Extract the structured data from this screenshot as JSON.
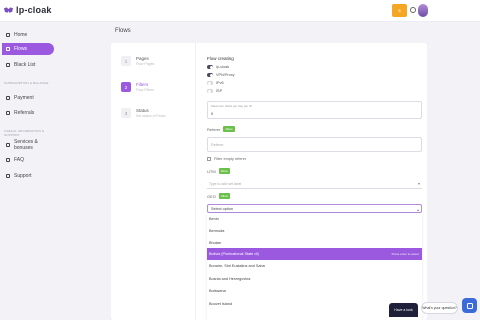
{
  "app": {
    "name": "lp-cloak"
  },
  "topbar": {
    "button_label": "$"
  },
  "sidebar": {
    "items": [
      {
        "label": "Home",
        "icon": "home-icon"
      },
      {
        "label": "Flows",
        "icon": "flows-icon",
        "active": true
      },
      {
        "label": "Black List",
        "icon": "blacklist-icon"
      }
    ],
    "section1": "SUBSCRIPTION & BALANCE",
    "items2": [
      {
        "label": "Payment",
        "icon": "payment-icon"
      },
      {
        "label": "Referrals",
        "icon": "referrals-icon"
      }
    ],
    "section2": "USEFUL INFORMATION & SUPPORT",
    "items3": [
      {
        "label": "Services & bonuses",
        "icon": "services-icon"
      },
      {
        "label": "FAQ",
        "icon": "faq-icon"
      },
      {
        "label": "Support",
        "icon": "support-icon"
      }
    ]
  },
  "page": {
    "title": "Flows"
  },
  "steps": [
    {
      "num": "1",
      "title": "Pages",
      "sub": "Flow Pages"
    },
    {
      "num": "2",
      "title": "Filters",
      "sub": "Flow Filters",
      "active": true
    },
    {
      "num": "3",
      "title": "Status",
      "sub": "Set status of Flows"
    }
  ],
  "form": {
    "title": "Flow creating",
    "toggles": [
      {
        "label": "lp-cloak",
        "on": true
      },
      {
        "label": "VPN/Proxy",
        "on": true
      },
      {
        "label": "IPv6",
        "on": false
      },
      {
        "label": "ISP",
        "on": false
      }
    ],
    "max_clicks": {
      "label": "Maximum clicks per day per IP",
      "value": "0"
    },
    "referer": {
      "label": "Referer",
      "badge": "Allow",
      "placeholder": "Referer"
    },
    "filter_empty": "Filter empty referer",
    "utm": {
      "label": "UTM",
      "badge": "Allow",
      "placeholder": "Type to add set label"
    },
    "geo": {
      "label": "GEO",
      "badge": "Allow",
      "selected": "Select option"
    },
    "options": [
      "Benin",
      "Bermuda",
      "Bhutan",
      "Bolivia (Plurinational State of)",
      "Bonaire, Sint Eustatius and Saba",
      "Bosnia and Herzegovina",
      "Botswana",
      "Bouvet Island"
    ],
    "highlighted_index": 3,
    "highlight_hint": "Press enter to select"
  },
  "chat": {
    "dark_label": "Have a look",
    "bubble": "What's your question?"
  },
  "colors": {
    "accent": "#9b59e0",
    "badge": "#6cc04a",
    "top_button": "#f5a623",
    "chat": "#3a6bd8"
  }
}
